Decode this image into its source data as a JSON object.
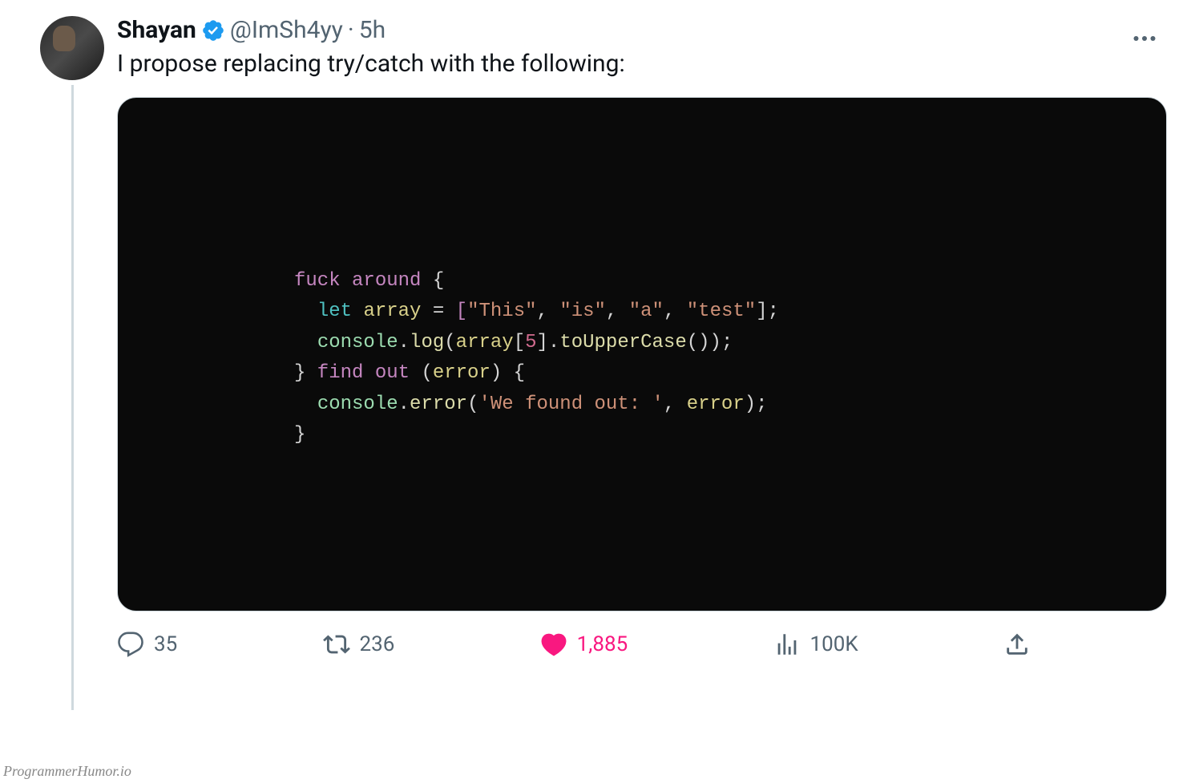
{
  "tweet": {
    "author": {
      "display_name": "Shayan",
      "handle": "@ImSh4yy",
      "verified": true
    },
    "separator": "·",
    "timestamp": "5h",
    "text": "I propose replacing try/catch with the following:",
    "code": {
      "line1_kw": "fuck around",
      "line1_brace": " {",
      "line2_indent": "  ",
      "line2_let": "let",
      "line2_sp": " ",
      "line2_var": "array",
      "line2_eq": " = ",
      "line2_open": "[",
      "line2_s1": "\"This\"",
      "line2_c1": ", ",
      "line2_s2": "\"is\"",
      "line2_c2": ", ",
      "line2_s3": "\"a\"",
      "line2_c3": ", ",
      "line2_s4": "\"test\"",
      "line2_close": "];",
      "line3_indent": "  ",
      "line3_obj": "console",
      "line3_dot": ".",
      "line3_fn": "log",
      "line3_p1": "(",
      "line3_var": "array",
      "line3_b1": "[",
      "line3_num": "5",
      "line3_b2": "]",
      "line3_dot2": ".",
      "line3_fn2": "toUpperCase",
      "line3_p2": "());",
      "line4_close": "}",
      "line4_kw": " find out ",
      "line4_p1": "(",
      "line4_var": "error",
      "line4_p2": ") {",
      "line5_indent": "  ",
      "line5_obj": "console",
      "line5_dot": ".",
      "line5_fn": "error",
      "line5_p1": "(",
      "line5_str": "'We found out: '",
      "line5_c": ", ",
      "line5_var": "error",
      "line5_p2": ");",
      "line6": "}"
    },
    "actions": {
      "replies": "35",
      "retweets": "236",
      "likes": "1,885",
      "views": "100K",
      "liked": true
    }
  },
  "watermark": "ProgrammerHumor.io"
}
